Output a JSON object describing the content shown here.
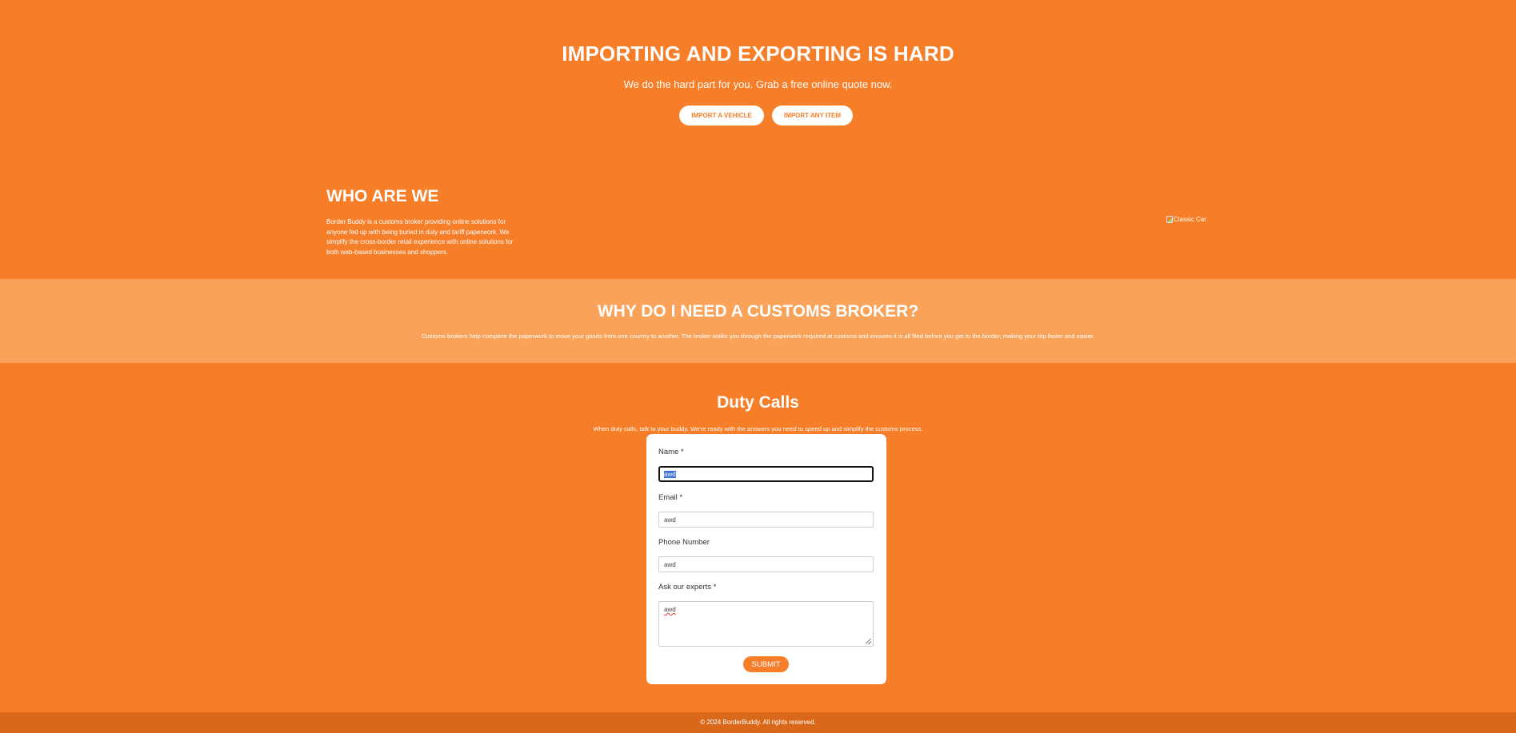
{
  "colors": {
    "background": "#F77E28",
    "why_band": "#F9A35A",
    "footer": "#D9681A",
    "card": "#FFFFFF"
  },
  "hero": {
    "title": "IMPORTING AND EXPORTING IS HARD",
    "subtitle": "We do the hard part for you. Grab a free online quote now.",
    "button_vehicle": "IMPORT A VEHICLE",
    "button_item": "IMPORT ANY ITEM"
  },
  "who": {
    "title": "WHO ARE WE",
    "text": "Border Buddy is a customs broker providing online solutions for anyone fed up with being buried in duty and tariff paperwork. We simplify the cross-border retail experience with online solutions for both web-based businesses and shoppers.",
    "image_alt": "Classic Car"
  },
  "why": {
    "title": "WHY DO I NEED A CUSTOMS BROKER?",
    "text": "Customs brokers help complete the paperwork to move your goods from one country to another. The broker walks you through the paperwork required at customs and ensures it is all filed before you get to the border, making your trip faster and easier."
  },
  "duty": {
    "title": "Duty Calls",
    "text": "When duty calls, talk to your buddy. We're ready with the answers you need to speed up and simplify the customs process."
  },
  "form": {
    "name_label": "Name *",
    "name_value": "awd",
    "email_label": "Email *",
    "email_value": "awd",
    "phone_label": "Phone Number",
    "phone_value": "awd",
    "ask_label": "Ask our experts *",
    "ask_value": "awd",
    "submit_label": "SUBMIT"
  },
  "footer": {
    "text": "© 2024 BorderBuddy. All rights reserved."
  }
}
